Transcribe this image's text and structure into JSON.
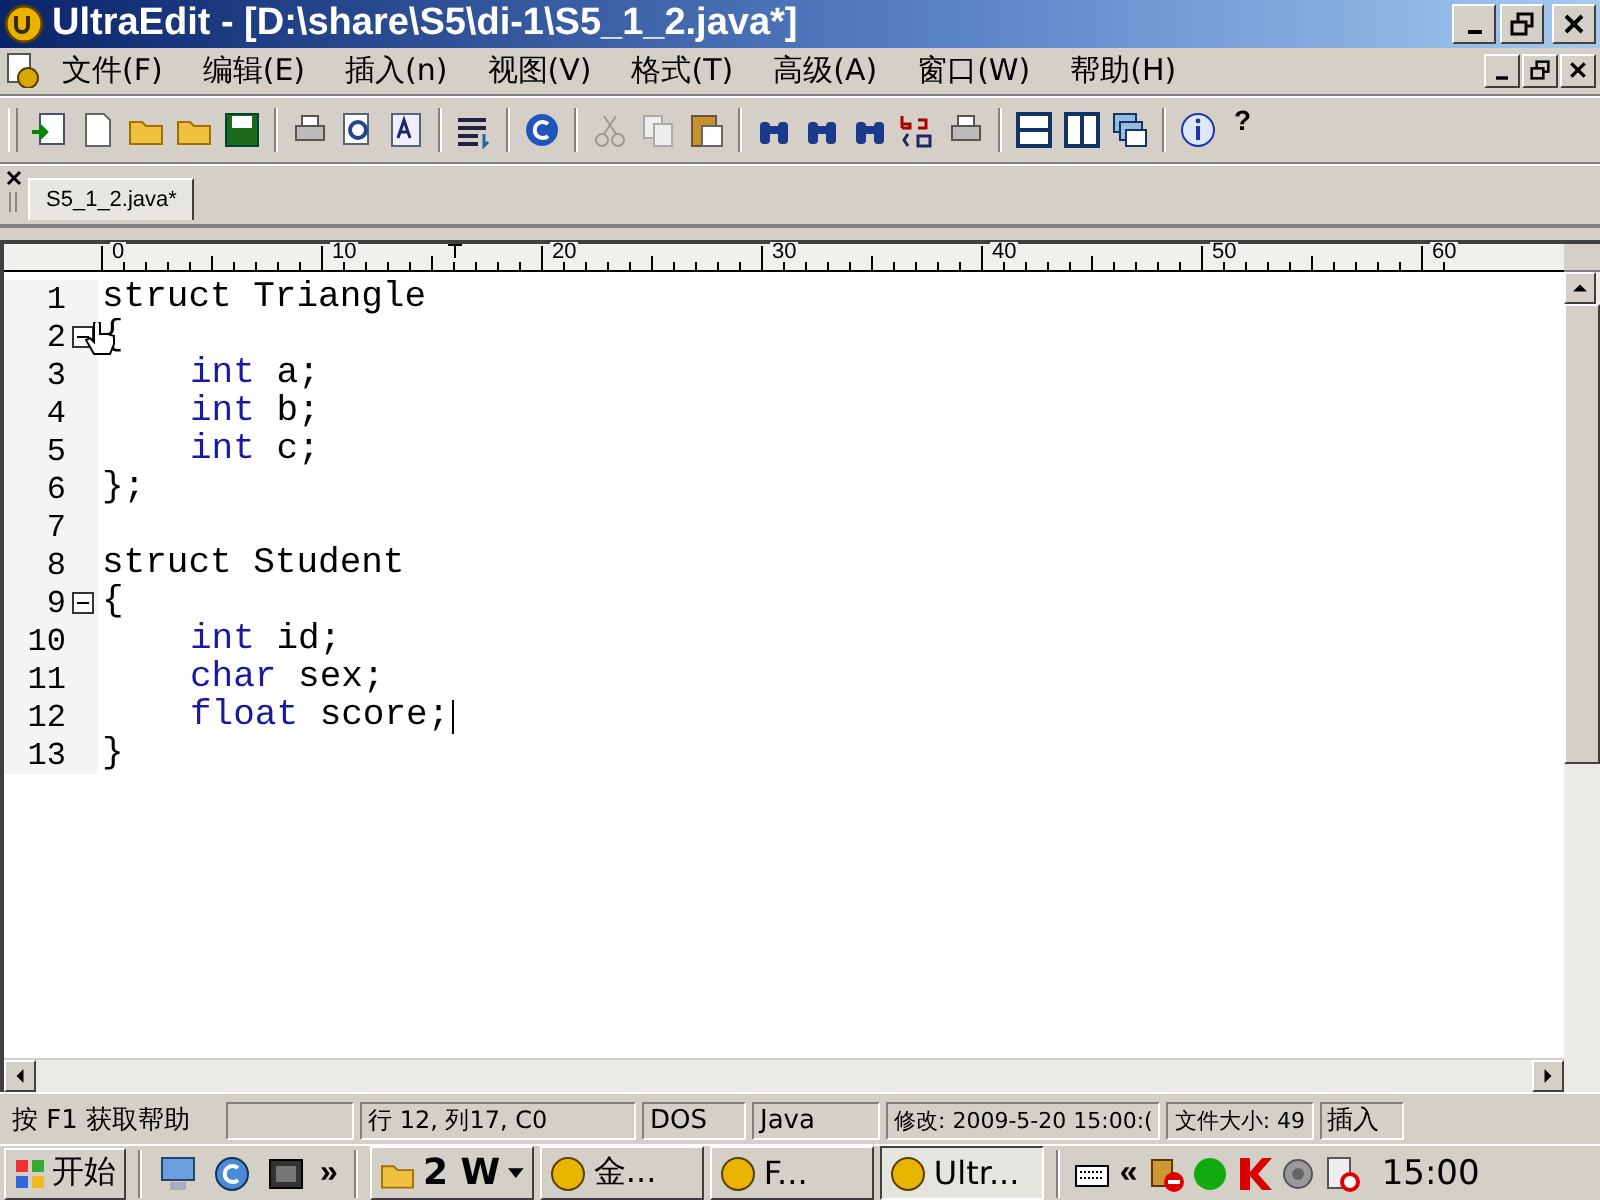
{
  "window": {
    "title": "UltraEdit - [D:\\share\\S5\\di-1\\S5_1_2.java*]"
  },
  "menu": [
    {
      "label": "文件(F)"
    },
    {
      "label": "编辑(E)"
    },
    {
      "label": "插入(n)"
    },
    {
      "label": "视图(V)"
    },
    {
      "label": "格式(T)"
    },
    {
      "label": "高级(A)"
    },
    {
      "label": "窗口(W)"
    },
    {
      "label": "帮助(H)"
    }
  ],
  "toolbar": {
    "help_label": "?"
  },
  "tabs": [
    {
      "label": "S5_1_2.java*",
      "selected": true
    }
  ],
  "ruler": {
    "labels": [
      "0",
      "10",
      "20",
      "30",
      "40",
      "50",
      "60"
    ]
  },
  "code": {
    "lines": [
      {
        "number": "1",
        "fold": false,
        "caret": false,
        "tokens": [
          {
            "text": "struct Triangle",
            "kind": "plain"
          }
        ]
      },
      {
        "number": "2",
        "fold": true,
        "caret": false,
        "tokens": [
          {
            "text": "{",
            "kind": "plain"
          }
        ]
      },
      {
        "number": "3",
        "fold": false,
        "caret": false,
        "indented": true,
        "tokens": [
          {
            "text": "int",
            "kind": "keyword"
          },
          {
            "text": " a;",
            "kind": "plain"
          }
        ]
      },
      {
        "number": "4",
        "fold": false,
        "caret": false,
        "indented": true,
        "tokens": [
          {
            "text": "int",
            "kind": "keyword"
          },
          {
            "text": " b;",
            "kind": "plain"
          }
        ]
      },
      {
        "number": "5",
        "fold": false,
        "caret": false,
        "indented": true,
        "tokens": [
          {
            "text": "int",
            "kind": "keyword"
          },
          {
            "text": " c;",
            "kind": "plain"
          }
        ]
      },
      {
        "number": "6",
        "fold": false,
        "caret": false,
        "tokens": [
          {
            "text": "};",
            "kind": "plain"
          }
        ]
      },
      {
        "number": "7",
        "fold": false,
        "caret": false
      },
      {
        "number": "8",
        "fold": false,
        "caret": false,
        "tokens": [
          {
            "text": "struct Student",
            "kind": "plain"
          }
        ]
      },
      {
        "number": "9",
        "fold": true,
        "caret": false,
        "tokens": [
          {
            "text": "{",
            "kind": "plain"
          }
        ]
      },
      {
        "number": "10",
        "fold": false,
        "caret": false,
        "indented": true,
        "tokens": [
          {
            "text": "int",
            "kind": "keyword"
          },
          {
            "text": " id;",
            "kind": "plain"
          }
        ]
      },
      {
        "number": "11",
        "fold": false,
        "caret": false,
        "indented": true,
        "tokens": [
          {
            "text": "char",
            "kind": "keyword"
          },
          {
            "text": " sex;",
            "kind": "plain"
          }
        ]
      },
      {
        "number": "12",
        "fold": false,
        "caret": true,
        "indented": true,
        "tokens": [
          {
            "text": "float",
            "kind": "keyword"
          },
          {
            "text": " score;",
            "kind": "plain"
          }
        ]
      },
      {
        "number": "13",
        "fold": false,
        "caret": false,
        "tokens": [
          {
            "text": "}",
            "kind": "plain"
          }
        ]
      }
    ]
  },
  "status_bar": [
    {
      "text": "按 F1 获取帮助"
    },
    {
      "text": "行 12, 列17, C0"
    },
    {
      "text": "DOS"
    },
    {
      "text": "Java"
    },
    {
      "text": "修改:  2009-5-20 15:00:("
    },
    {
      "text": "文件大小:     49"
    },
    {
      "text": "插入"
    }
  ],
  "taskbar": {
    "start": "开始",
    "quick_launch_more": "»",
    "tasks": [
      {
        "label": "2 W",
        "kind": "group",
        "selected": false
      },
      {
        "label": "金...",
        "kind": "window",
        "selected": false
      },
      {
        "label": "F...",
        "kind": "window",
        "selected": false
      },
      {
        "label": "Ultr...",
        "kind": "window",
        "selected": true
      }
    ],
    "tray_expand": "«",
    "clock": "15:00"
  }
}
